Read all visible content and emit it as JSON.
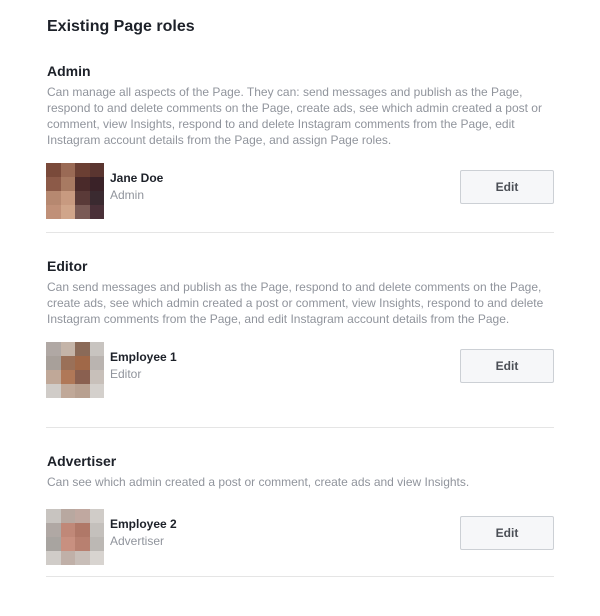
{
  "page_title": "Existing Page roles",
  "roles": [
    {
      "title": "Admin",
      "description": "Can manage all aspects of the Page. They can: send messages and publish as the Page, respond to and delete comments on the Page, create ads, see which admin created a post or comment, view Insights, respond to and delete Instagram comments from the Page, edit Instagram account details from the Page, and assign Page roles.",
      "person": {
        "name": "Jane Doe",
        "role": "Admin",
        "avatar_colors": [
          "#7a4a3a",
          "#9a6a55",
          "#6b3f33",
          "#5a3530",
          "#8c5a48",
          "#a87a62",
          "#4a2a2a",
          "#3a2228",
          "#b68870",
          "#c89a80",
          "#5a3a38",
          "#3a2a30",
          "#c09078",
          "#d0a58a",
          "#7a5a55",
          "#4a3038"
        ]
      },
      "edit_label": "Edit"
    },
    {
      "title": "Editor",
      "description": "Can send messages and publish as the Page, respond to and delete comments on the Page, create ads, see which admin created a post or comment, view Insights, respond to and delete Instagram comments from the Page, and edit Instagram account details from the Page.",
      "person": {
        "name": "Employee 1",
        "role": "Editor",
        "avatar_colors": [
          "#b0a8a4",
          "#c4b4a8",
          "#8a6a58",
          "#c8c4c0",
          "#a8a09a",
          "#9a7058",
          "#a06848",
          "#bab4b0",
          "#c0a898",
          "#b07858",
          "#8a6050",
          "#c8c0ba",
          "#d0ccc8",
          "#c0a898",
          "#b8a090",
          "#d4d0cc"
        ]
      },
      "edit_label": "Edit"
    },
    {
      "title": "Advertiser",
      "description": "Can see which admin created a post or comment, create ads and view Insights.",
      "person": {
        "name": "Employee 2",
        "role": "Advertiser",
        "avatar_colors": [
          "#c8c4c0",
          "#b8a8a0",
          "#c0a8a0",
          "#d0ccc8",
          "#b0a8a4",
          "#c08878",
          "#b07868",
          "#c4c0bc",
          "#a8a4a0",
          "#c89080",
          "#b88070",
          "#bcb8b4",
          "#d0ccc8",
          "#c0b0a8",
          "#c8beb8",
          "#d8d4d0"
        ]
      },
      "edit_label": "Edit"
    }
  ]
}
